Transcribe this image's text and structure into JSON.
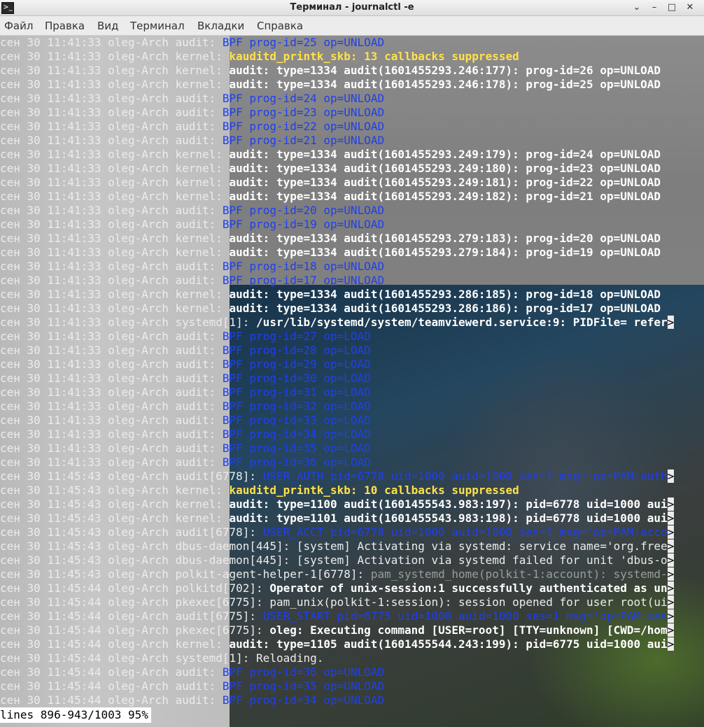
{
  "window": {
    "title": "Терминал - journalctl -e",
    "app_icon": ">_",
    "minimize_glyph": "–",
    "maximize_glyph": "□",
    "close_glyph": "✕",
    "menu_glyph": "⌄"
  },
  "menu": [
    "Файл",
    "Правка",
    "Вид",
    "Терминал",
    "Вкладки",
    "Справка"
  ],
  "colors": {
    "blue_message": "#1f3ff0",
    "yellow_message": "#ffe14a",
    "terminal_text": "#ececec"
  },
  "log": [
    {
      "prefix": "сен 30 11:41:33 oleg-Arch audit: ",
      "msg": "BPF prog-id=25 op=UNLOAD",
      "style": "blue"
    },
    {
      "prefix": "сен 30 11:41:33 oleg-Arch kernel: ",
      "msg": "kauditd_printk_skb: 13 callbacks suppressed",
      "style": "yellow"
    },
    {
      "prefix": "сен 30 11:41:33 oleg-Arch kernel: ",
      "msg": "audit: type=1334 audit(1601455293.246:177): prog-id=26 op=UNLOAD",
      "style": "bold"
    },
    {
      "prefix": "сен 30 11:41:33 oleg-Arch kernel: ",
      "msg": "audit: type=1334 audit(1601455293.246:178): prog-id=25 op=UNLOAD",
      "style": "bold"
    },
    {
      "prefix": "сен 30 11:41:33 oleg-Arch audit: ",
      "msg": "BPF prog-id=24 op=UNLOAD",
      "style": "blue"
    },
    {
      "prefix": "сен 30 11:41:33 oleg-Arch audit: ",
      "msg": "BPF prog-id=23 op=UNLOAD",
      "style": "blue"
    },
    {
      "prefix": "сен 30 11:41:33 oleg-Arch audit: ",
      "msg": "BPF prog-id=22 op=UNLOAD",
      "style": "blue"
    },
    {
      "prefix": "сен 30 11:41:33 oleg-Arch audit: ",
      "msg": "BPF prog-id=21 op=UNLOAD",
      "style": "blue"
    },
    {
      "prefix": "сен 30 11:41:33 oleg-Arch kernel: ",
      "msg": "audit: type=1334 audit(1601455293.249:179): prog-id=24 op=UNLOAD",
      "style": "bold"
    },
    {
      "prefix": "сен 30 11:41:33 oleg-Arch kernel: ",
      "msg": "audit: type=1334 audit(1601455293.249:180): prog-id=23 op=UNLOAD",
      "style": "bold"
    },
    {
      "prefix": "сен 30 11:41:33 oleg-Arch kernel: ",
      "msg": "audit: type=1334 audit(1601455293.249:181): prog-id=22 op=UNLOAD",
      "style": "bold"
    },
    {
      "prefix": "сен 30 11:41:33 oleg-Arch kernel: ",
      "msg": "audit: type=1334 audit(1601455293.249:182): prog-id=21 op=UNLOAD",
      "style": "bold"
    },
    {
      "prefix": "сен 30 11:41:33 oleg-Arch audit: ",
      "msg": "BPF prog-id=20 op=UNLOAD",
      "style": "blue"
    },
    {
      "prefix": "сен 30 11:41:33 oleg-Arch audit: ",
      "msg": "BPF prog-id=19 op=UNLOAD",
      "style": "blue"
    },
    {
      "prefix": "сен 30 11:41:33 oleg-Arch kernel: ",
      "msg": "audit: type=1334 audit(1601455293.279:183): prog-id=20 op=UNLOAD",
      "style": "bold"
    },
    {
      "prefix": "сен 30 11:41:33 oleg-Arch kernel: ",
      "msg": "audit: type=1334 audit(1601455293.279:184): prog-id=19 op=UNLOAD",
      "style": "bold"
    },
    {
      "prefix": "сен 30 11:41:33 oleg-Arch audit: ",
      "msg": "BPF prog-id=18 op=UNLOAD",
      "style": "blue"
    },
    {
      "prefix": "сен 30 11:41:33 oleg-Arch audit: ",
      "msg": "BPF prog-id=17 op=UNLOAD",
      "style": "blue"
    },
    {
      "prefix": "сен 30 11:41:33 oleg-Arch kernel: ",
      "msg": "audit: type=1334 audit(1601455293.286:185): prog-id=18 op=UNLOAD",
      "style": "bold"
    },
    {
      "prefix": "сен 30 11:41:33 oleg-Arch kernel: ",
      "msg": "audit: type=1334 audit(1601455293.286:186): prog-id=17 op=UNLOAD",
      "style": "bold"
    },
    {
      "prefix": "сен 30 11:41:33 oleg-Arch systemd[1]: ",
      "msg": "/usr/lib/systemd/system/teamviewerd.service:9: PIDFile= refer",
      "style": "bold",
      "truncated": true
    },
    {
      "prefix": "сен 30 11:41:33 oleg-Arch audit: ",
      "msg": "BPF prog-id=27 op=LOAD",
      "style": "blue"
    },
    {
      "prefix": "сен 30 11:41:33 oleg-Arch audit: ",
      "msg": "BPF prog-id=28 op=LOAD",
      "style": "blue"
    },
    {
      "prefix": "сен 30 11:41:33 oleg-Arch audit: ",
      "msg": "BPF prog-id=29 op=LOAD",
      "style": "blue"
    },
    {
      "prefix": "сен 30 11:41:33 oleg-Arch audit: ",
      "msg": "BPF prog-id=30 op=LOAD",
      "style": "blue"
    },
    {
      "prefix": "сен 30 11:41:33 oleg-Arch audit: ",
      "msg": "BPF prog-id=31 op=LOAD",
      "style": "blue"
    },
    {
      "prefix": "сен 30 11:41:33 oleg-Arch audit: ",
      "msg": "BPF prog-id=32 op=LOAD",
      "style": "blue"
    },
    {
      "prefix": "сен 30 11:41:33 oleg-Arch audit: ",
      "msg": "BPF prog-id=33 op=LOAD",
      "style": "blue"
    },
    {
      "prefix": "сен 30 11:41:33 oleg-Arch audit: ",
      "msg": "BPF prog-id=34 op=LOAD",
      "style": "blue"
    },
    {
      "prefix": "сен 30 11:41:33 oleg-Arch audit: ",
      "msg": "BPF prog-id=35 op=LOAD",
      "style": "blue"
    },
    {
      "prefix": "сен 30 11:41:33 oleg-Arch audit: ",
      "msg": "BPF prog-id=36 op=LOAD",
      "style": "blue"
    },
    {
      "prefix": "сен 30 11:45:43 oleg-Arch audit[6778]: ",
      "msg": "USER_AUTH pid=6778 uid=1000 auid=1000 ses=1 msg='op=PAM:auth",
      "style": "blue",
      "truncated": true
    },
    {
      "prefix": "сен 30 11:45:43 oleg-Arch kernel: ",
      "msg": "kauditd_printk_skb: 10 callbacks suppressed",
      "style": "yellow"
    },
    {
      "prefix": "сен 30 11:45:43 oleg-Arch kernel: ",
      "msg": "audit: type=1100 audit(1601455543.983:197): pid=6778 uid=1000 aui",
      "style": "bold",
      "truncated": true
    },
    {
      "prefix": "сен 30 11:45:43 oleg-Arch kernel: ",
      "msg": "audit: type=1101 audit(1601455543.983:198): pid=6778 uid=1000 aui",
      "style": "bold",
      "truncated": true
    },
    {
      "prefix": "сен 30 11:45:43 oleg-Arch audit[6778]: ",
      "msg": "USER_ACCT pid=6778 uid=1000 auid=1000 ses=1 msg='op=PAM:acco",
      "style": "blue",
      "truncated": true
    },
    {
      "prefix": "сен 30 11:45:43 oleg-Arch dbus-daemon[445]: ",
      "msg": "[system] Activating via systemd: service name='org.free",
      "style": "norm",
      "truncated": true
    },
    {
      "prefix": "сен 30 11:45:43 oleg-Arch dbus-daemon[445]: ",
      "msg": "[system] Activation via systemd failed for unit 'dbus-o",
      "style": "norm",
      "truncated": true
    },
    {
      "prefix": "сен 30 11:45:43 oleg-Arch polkit-agent-helper-1[6778]: ",
      "msg": "pam_systemd_home(polkit-1:account): systemd-",
      "style": "gray",
      "truncated": true
    },
    {
      "prefix": "сен 30 11:45:44 oleg-Arch polkitd[702]: ",
      "msg": "Operator of unix-session:1 successfully authenticated as un",
      "style": "bold",
      "truncated": true
    },
    {
      "prefix": "сен 30 11:45:44 oleg-Arch pkexec[6775]: ",
      "msg": "pam_unix(polkit-1:session): session opened for user root(ui",
      "style": "norm",
      "truncated": true
    },
    {
      "prefix": "сен 30 11:45:44 oleg-Arch audit[6775]: ",
      "msg": "USER_START pid=6775 uid=1000 auid=1000 ses=1 msg='op=PAM:ses",
      "style": "blue",
      "truncated": true
    },
    {
      "prefix": "сен 30 11:45:44 oleg-Arch pkexec[6775]: ",
      "msg": "oleg: Executing command [USER=root] [TTY=unknown] [CWD=/hom",
      "style": "bold",
      "truncated": true
    },
    {
      "prefix": "сен 30 11:45:44 oleg-Arch kernel: ",
      "msg": "audit: type=1105 audit(1601455544.243:199): pid=6775 uid=1000 aui",
      "style": "bold",
      "truncated": true
    },
    {
      "prefix": "сен 30 11:45:44 oleg-Arch systemd[1]: ",
      "msg": "Reloading.",
      "style": "norm"
    },
    {
      "prefix": "сен 30 11:45:44 oleg-Arch audit: ",
      "msg": "BPF prog-id=36 op=UNLOAD",
      "style": "blue"
    },
    {
      "prefix": "сен 30 11:45:44 oleg-Arch audit: ",
      "msg": "BPF prog-id=35 op=UNLOAD",
      "style": "blue"
    },
    {
      "prefix": "сен 30 11:45:44 oleg-Arch audit: ",
      "msg": "BPF prog-id=34 op=UNLOAD",
      "style": "blue"
    }
  ],
  "truncation_marker": ">",
  "status": "lines 896-943/1003 95%"
}
